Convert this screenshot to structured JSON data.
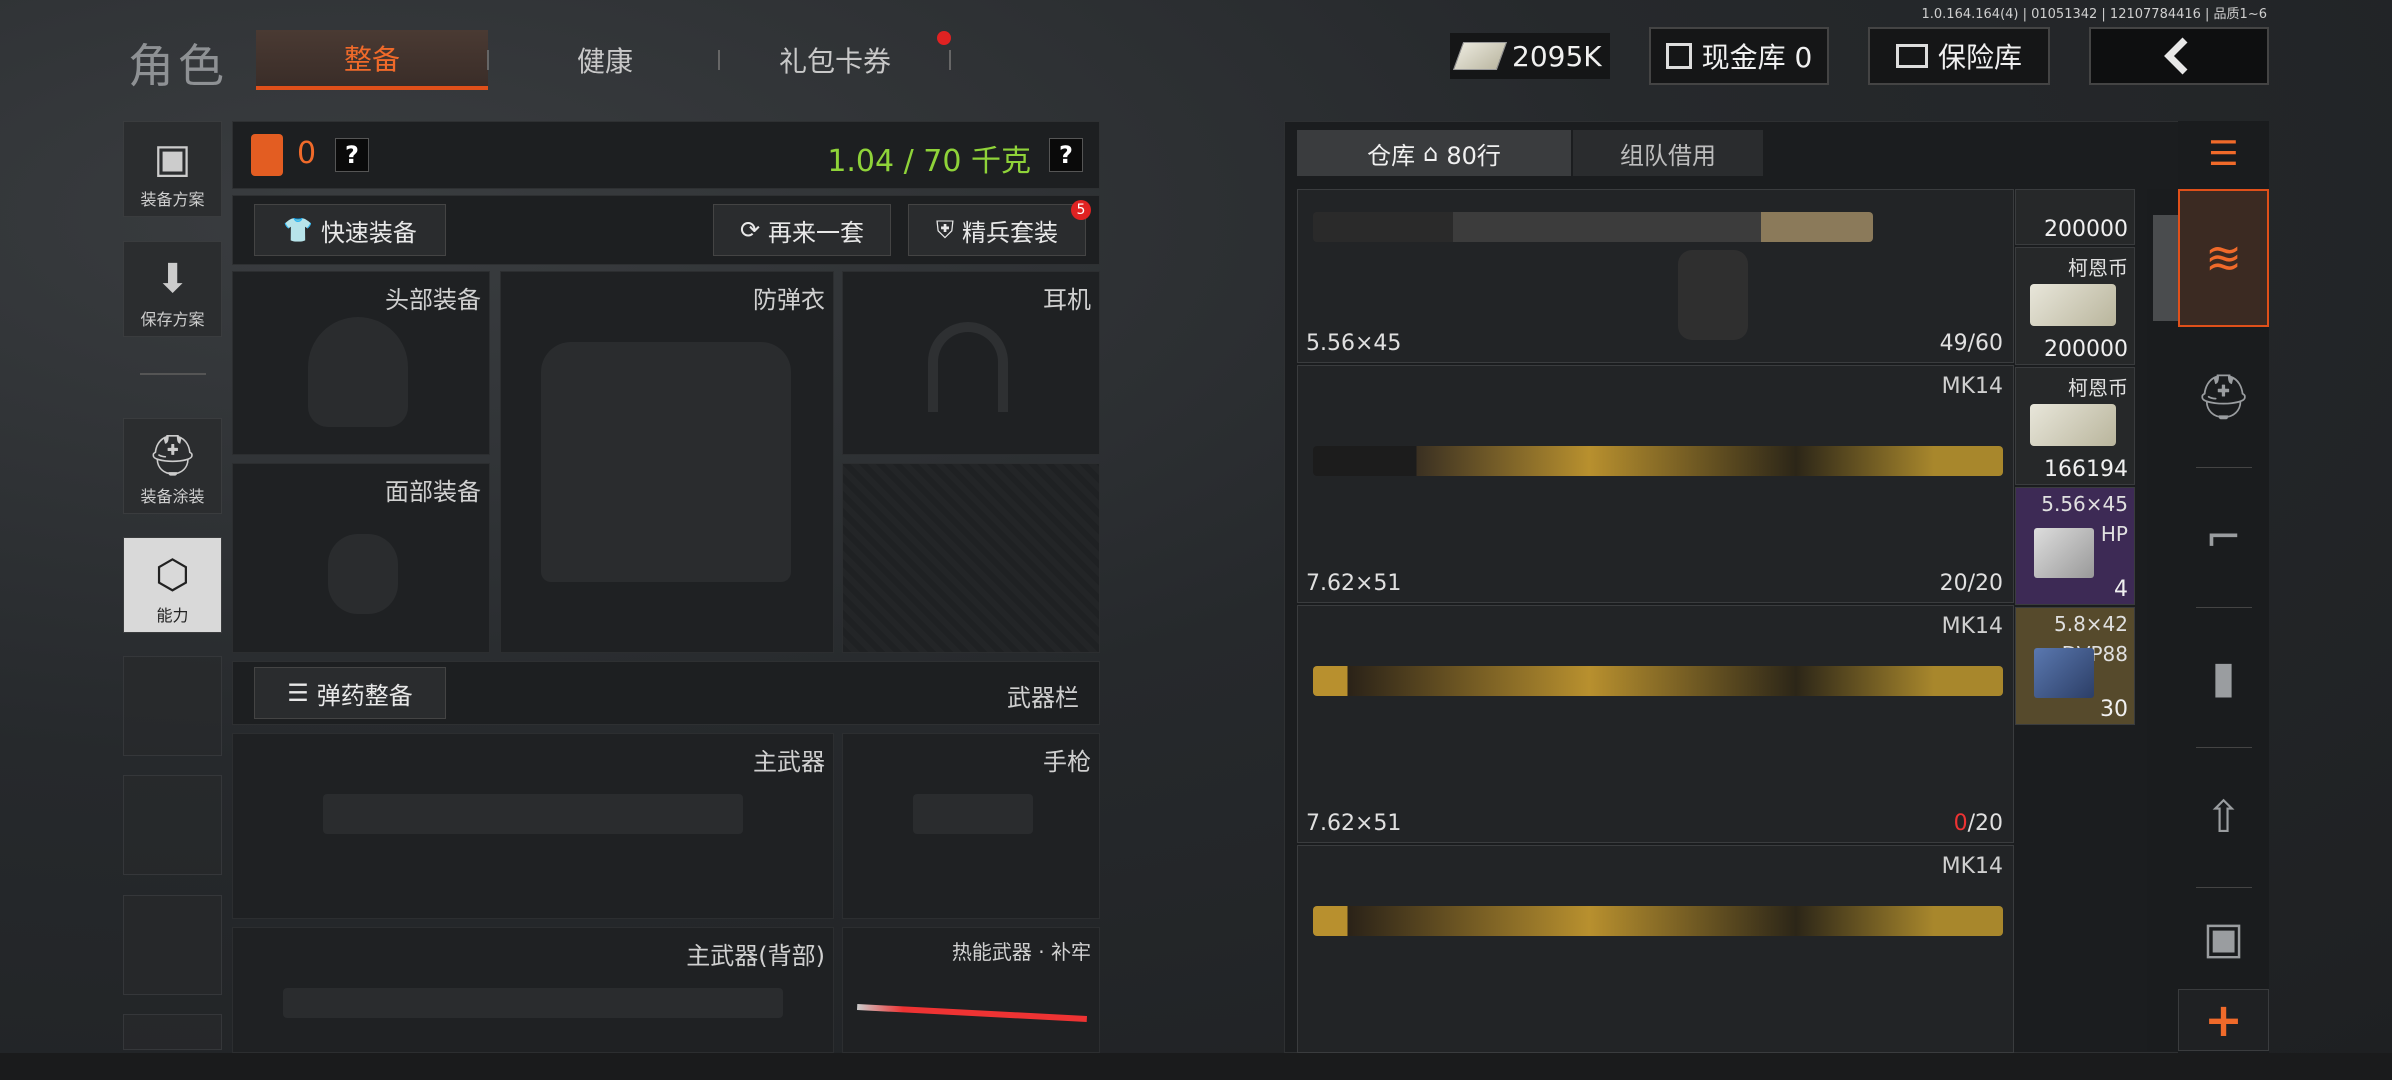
{
  "version": "1.0.164.164(4) | 01051342 | 12107784416 | 品质1~6",
  "header": {
    "title": "角色",
    "tabs": [
      {
        "label": "整备",
        "active": true
      },
      {
        "label": "健康",
        "active": false
      },
      {
        "label": "礼包卡券",
        "active": false
      }
    ],
    "currency": "2095K",
    "cash_vault": "现金库 0",
    "insurance_vault": "保险库",
    "back_icon": "chevron-left-icon"
  },
  "left_nav": [
    {
      "label": "装备方案",
      "icon": "vest-icon"
    },
    {
      "label": "保存方案",
      "icon": "download-icon"
    },
    {
      "label": "装备涂装",
      "icon": "helmet-icon"
    },
    {
      "label": "能力",
      "icon": "ability-icon"
    }
  ],
  "loadout": {
    "value": "0",
    "weight": "1.04 / 70 千克",
    "quick_equip": "快速装备",
    "again": "再来一套",
    "elite": "精兵套装",
    "elite_badge": "5",
    "slots": {
      "head": "头部装备",
      "armor": "防弹衣",
      "earphone": "耳机",
      "face": "面部装备"
    },
    "ammo_button": "弹药整备",
    "weapon_bar": "武器栏",
    "weapon_slots": {
      "primary": "主武器",
      "pistol": "手枪",
      "primary_back": "主武器(背部)",
      "thermal": "热能武器 · 补牢"
    }
  },
  "warehouse": {
    "tab_main": "仓库",
    "rows": "80行",
    "tab_team": "组队借用",
    "weapons": [
      {
        "name": "",
        "caliber": "5.56×45",
        "count": "49/60"
      },
      {
        "name": "MK14",
        "caliber": "7.62×51",
        "count": "20/20"
      },
      {
        "name": "MK14",
        "caliber": "7.62×51",
        "count_zero": "0",
        "count_rest": "/20"
      },
      {
        "name": "MK14",
        "caliber": "",
        "count": ""
      }
    ],
    "items": [
      {
        "title": "",
        "value": "200000"
      },
      {
        "title": "柯恩币",
        "value": "200000"
      },
      {
        "title": "柯恩币",
        "value": "166194"
      },
      {
        "title": "5.56×45",
        "sub": "HP",
        "value": "4"
      },
      {
        "title": "5.8×42",
        "sub": "DVP88",
        "value": "30"
      }
    ]
  },
  "categories": [
    "all-icon",
    "helmet-icon",
    "rifle-icon",
    "magazine-icon",
    "ammo-icon",
    "armor-icon"
  ],
  "add_label": "+"
}
